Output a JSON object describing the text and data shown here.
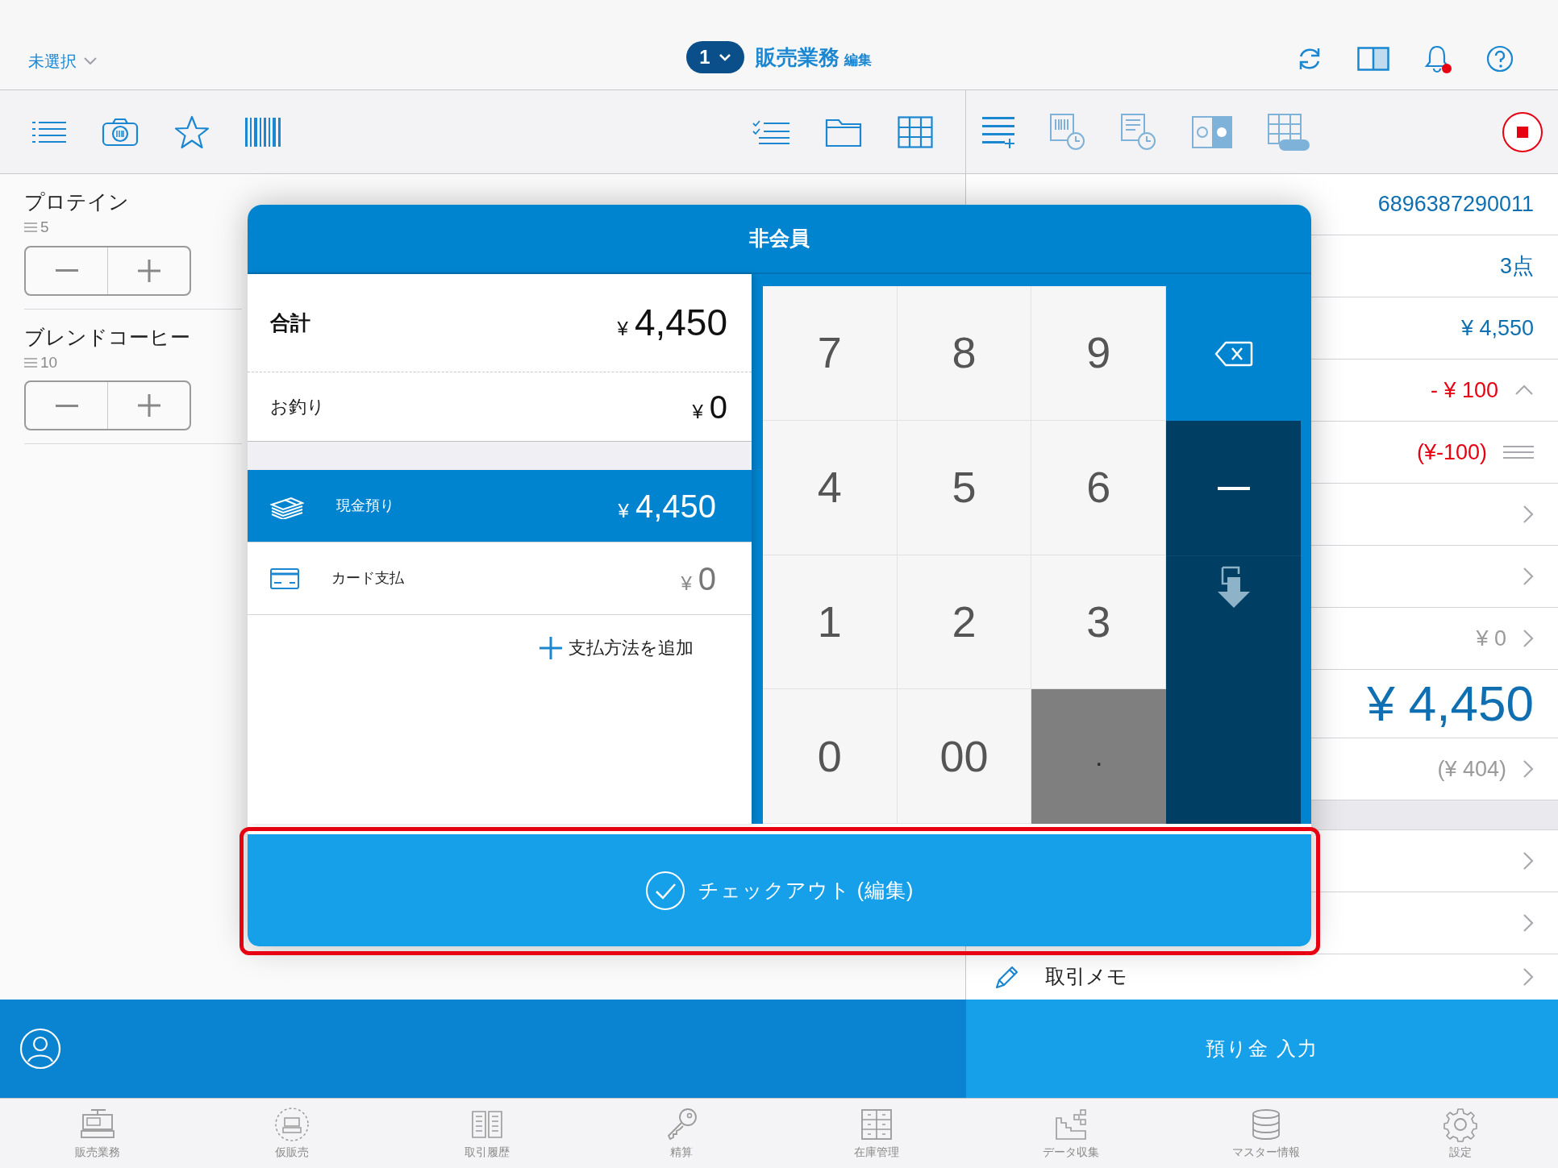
{
  "top_bar": {
    "staff_selector": "未選択",
    "register_number": "1",
    "title": "販売業務",
    "title_badge": "編集",
    "has_unread_notifications": true
  },
  "cart_items": [
    {
      "name": "プロテイン",
      "quantity": "5"
    },
    {
      "name": "ブレンドコーヒー",
      "quantity": "10"
    }
  ],
  "summary_rows": [
    {
      "value": "6896387290011",
      "color": "#0f6fb0"
    },
    {
      "value": "3点",
      "color": "#0f6fb0"
    },
    {
      "value": "¥ 4,550",
      "color": "#0f6fb0"
    },
    {
      "value": "- ¥ 100",
      "color": "#e60012",
      "collapsible": true
    },
    {
      "value": "(¥-100)",
      "color": "#e60012",
      "reorderable": true
    },
    {
      "chevron": true
    },
    {
      "chevron": true
    },
    {
      "value": "¥ 0",
      "color": "#9a9a9a",
      "chevron": true
    },
    {
      "value": "¥ 4,450",
      "color": "#0f6fb0",
      "large": true
    },
    {
      "value": "(¥ 404)",
      "color": "#9a9a9a",
      "chevron": true
    }
  ],
  "detail_rows": [
    {
      "chevron": true
    },
    {
      "chevron": true
    },
    {
      "label": "取引メモ",
      "chevron": true
    }
  ],
  "deposit_button": "預り金 入力",
  "modal": {
    "title": "非会員",
    "totals": [
      {
        "label": "合計",
        "currency": "¥",
        "amount": "4,450",
        "emphasis": true
      },
      {
        "label": "お釣り",
        "currency": "¥",
        "amount": "0",
        "emphasis": false
      }
    ],
    "payments": [
      {
        "kind": "cash",
        "label": "現金預り",
        "currency": "¥",
        "amount": "4,450",
        "selected": true
      },
      {
        "kind": "card",
        "label": "カード支払",
        "currency": "¥",
        "amount": "0",
        "selected": false
      }
    ],
    "add_payment": "支払方法を追加",
    "keypad": [
      {
        "kind": "digit",
        "label": "7"
      },
      {
        "kind": "digit",
        "label": "8"
      },
      {
        "kind": "digit",
        "label": "9"
      },
      {
        "kind": "digit",
        "label": "4"
      },
      {
        "kind": "digit",
        "label": "5"
      },
      {
        "kind": "digit",
        "label": "6"
      },
      {
        "kind": "digit",
        "label": "1"
      },
      {
        "kind": "digit",
        "label": "2"
      },
      {
        "kind": "digit",
        "label": "3"
      },
      {
        "kind": "digit",
        "label": "0"
      },
      {
        "kind": "digit",
        "label": "00"
      },
      {
        "kind": "dot",
        "label": "."
      }
    ],
    "checkout_button": "チェックアウト (編集)"
  },
  "tab_bar": [
    {
      "kind": "register",
      "label": "販売業務"
    },
    {
      "kind": "temp",
      "label": "仮販売"
    },
    {
      "kind": "history",
      "label": "取引履歴"
    },
    {
      "kind": "settlement",
      "label": "精算"
    },
    {
      "kind": "inventory",
      "label": "在庫管理"
    },
    {
      "kind": "data",
      "label": "データ収集"
    },
    {
      "kind": "master",
      "label": "マスター情報"
    },
    {
      "kind": "settings",
      "label": "設定"
    }
  ]
}
